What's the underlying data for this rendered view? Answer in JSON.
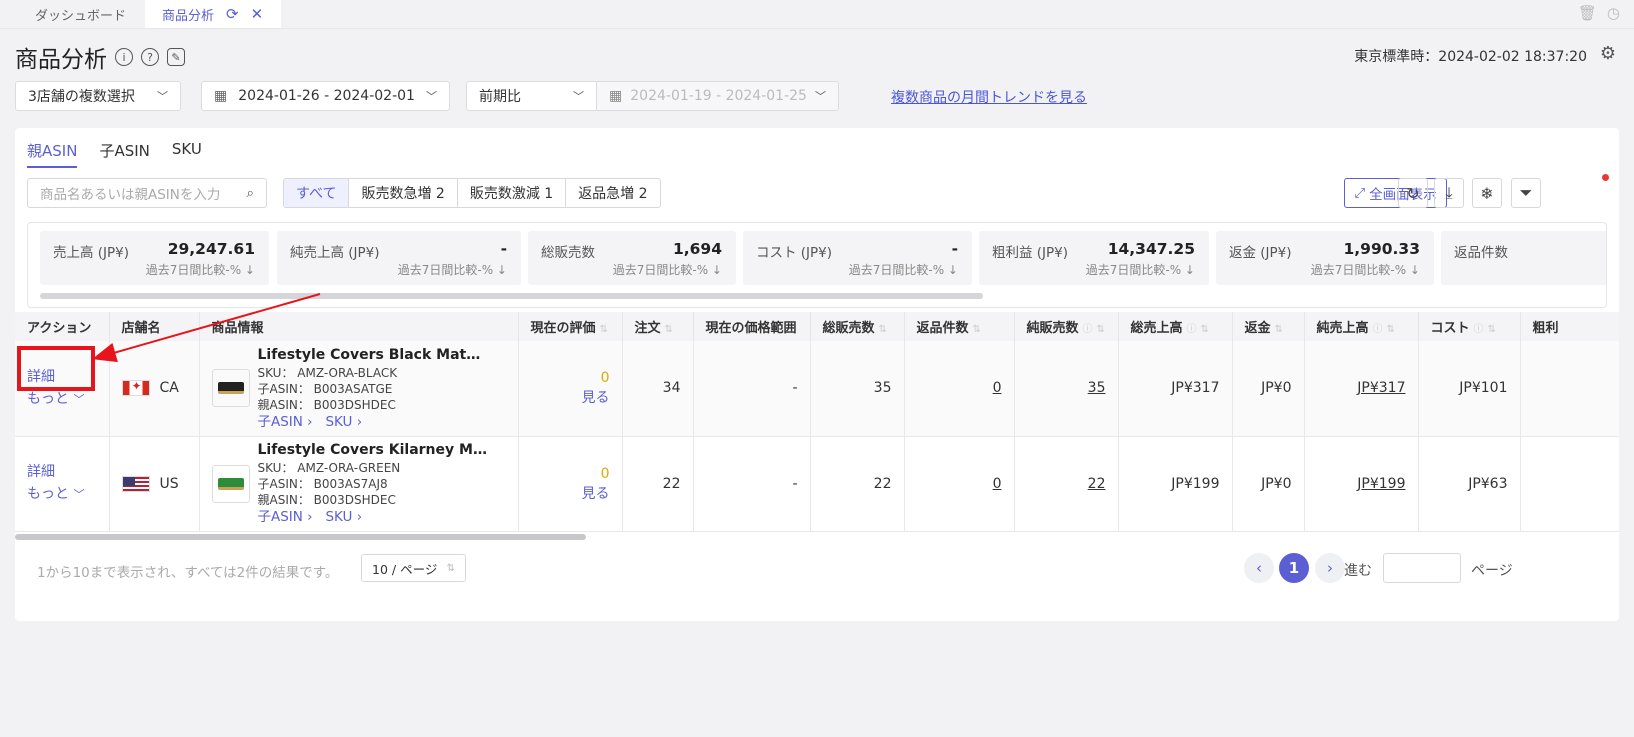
{
  "tabs": [
    {
      "label": "ダッシュボード"
    },
    {
      "label": "商品分析"
    }
  ],
  "page": {
    "title": "商品分析",
    "clock_label": "東京標準時：",
    "clock_value": "2024-02-02 18:37:20"
  },
  "filters": {
    "stores": "3店舗の複数選択",
    "date_range": "2024-01-26 - 2024-02-01",
    "compare_mode": "前期比",
    "compare_range": "2024-01-19 -  2024-01-25",
    "trend_link": "複数商品の月間トレンドを見る"
  },
  "subtabs": [
    "親ASIN",
    "子ASIN",
    "SKU"
  ],
  "search": {
    "placeholder": "商品名あるいは親ASINを入力"
  },
  "segments": [
    "すべて",
    "販売数急増 2",
    "販売数激減 1",
    "返品急増 2"
  ],
  "toolbar": {
    "fullscreen_label": "全画面表示"
  },
  "metrics": [
    {
      "label": "売上高 (JP¥)",
      "value": "29,247.61",
      "compare": "過去7日間比較-% ↓"
    },
    {
      "label": "純売上高 (JP¥)",
      "value": "-",
      "compare": "過去7日間比較-% ↓"
    },
    {
      "label": "総販売数",
      "value": "1,694",
      "compare": "過去7日間比較-% ↓"
    },
    {
      "label": "コスト (JP¥)",
      "value": "-",
      "compare": "過去7日間比較-% ↓"
    },
    {
      "label": "粗利益 (JP¥)",
      "value": "14,347.25",
      "compare": "過去7日間比較-% ↓"
    },
    {
      "label": "返金 (JP¥)",
      "value": "1,990.33",
      "compare": "過去7日間比較-% ↓"
    },
    {
      "label": "返品件数",
      "value": "",
      "compare": ""
    }
  ],
  "table": {
    "headers": [
      "アクション",
      "店舗名",
      "商品情報",
      "現在の評価",
      "注文",
      "現在の価格範囲",
      "総販売数",
      "返品件数",
      "純販売数",
      "総売上高",
      "返金",
      "純売上高",
      "コスト",
      "粗利"
    ],
    "rows": [
      {
        "detail": "詳細",
        "more": "もっと",
        "store": "CA",
        "title": "Lifestyle Covers Black Matching Slipcover",
        "sku": "SKU： AMZ-ORA-BLACK",
        "child_asin": "子ASIN： B003ASATGE",
        "parent_asin": "親ASIN： B003DSHDEC",
        "child_link": "子ASIN",
        "sku_link": "SKU",
        "rating": "0",
        "view": "見る",
        "orders": "34",
        "price_range": "-",
        "total_units": "35",
        "returns": "0",
        "net_units": "35",
        "gross_sales": "JP¥317",
        "refund": "JP¥0",
        "net_sales": "JP¥317",
        "cost": "JP¥101"
      },
      {
        "detail": "詳細",
        "more": "もっと",
        "store": "US",
        "title": "Lifestyle Covers Kilarney Matching Slipcover",
        "sku": "SKU： AMZ-ORA-GREEN",
        "child_asin": "子ASIN： B003AS7AJ8",
        "parent_asin": "親ASIN： B003DSHDEC",
        "child_link": "子ASIN",
        "sku_link": "SKU",
        "rating": "0",
        "view": "見る",
        "orders": "22",
        "price_range": "-",
        "total_units": "22",
        "returns": "0",
        "net_units": "22",
        "gross_sales": "JP¥199",
        "refund": "JP¥0",
        "net_sales": "JP¥199",
        "cost": "JP¥63"
      }
    ]
  },
  "footer": {
    "summary": "1から10まで表示され、すべては2件の結果です。",
    "page_size": "10 / ページ",
    "current_page": "1",
    "goto_label": "進む",
    "page_word": "ページ"
  },
  "colors": {
    "accent": "#5b5fd3",
    "highlight": "#e8141b",
    "rating": "#e0a800"
  }
}
